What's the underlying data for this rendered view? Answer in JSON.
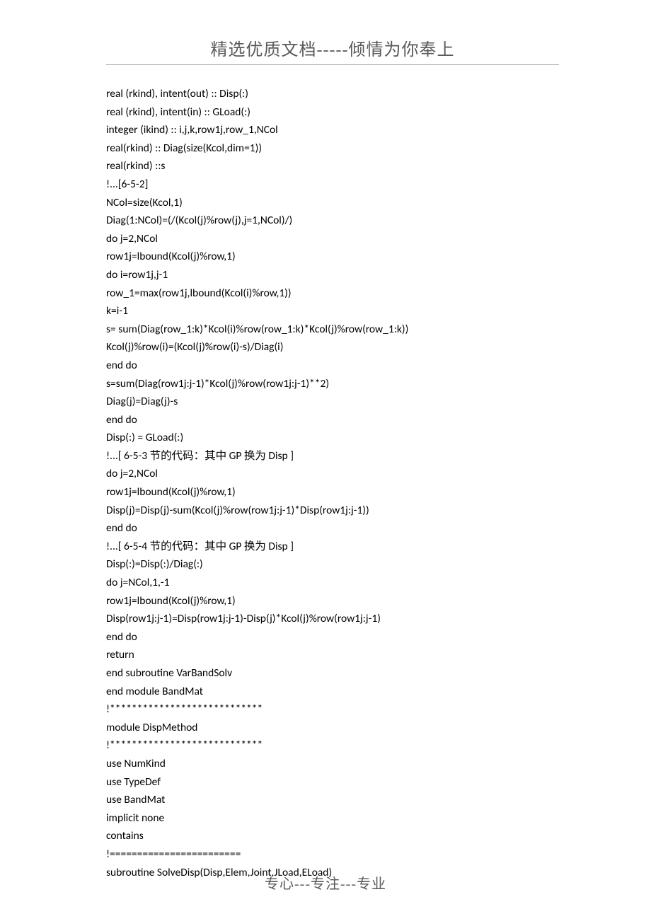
{
  "header": "精选优质文档-----倾情为你奉上",
  "footer": "专心---专注---专业",
  "code_lines": [
    "real (rkind), intent(out) :: Disp(:)",
    "real (rkind), intent(in) :: GLoad(:)",
    "integer (ikind) :: i,j,k,row1j,row_1,NCol",
    "real(rkind) :: Diag(size(Kcol,dim=1))",
    "real(rkind) ::s",
    "!...[6-5-2]",
    "NCol=size(Kcol,1)",
    "Diag(1:NCol)=(/(Kcol(j)%row(j),j=1,NCol)/)",
    "do j=2,NCol",
    "row1j=lbound(Kcol(j)%row,1)",
    "do i=row1j,j-1",
    "row_1=max(row1j,lbound(Kcol(i)%row,1))",
    "k=i-1",
    "s= sum(Diag(row_1:k)*Kcol(i)%row(row_1:k)*Kcol(j)%row(row_1:k))",
    "Kcol(j)%row(i)=(Kcol(j)%row(i)-s)/Diag(i)",
    "end do",
    "s=sum(Diag(row1j:j-1)*Kcol(j)%row(row1j:j-1)**2)",
    "Diag(j)=Diag(j)-s",
    "end do",
    "Disp(:) = GLoad(:)",
    "!...[ 6-5-3 节的代码：其中 GP 换为 Disp ]",
    "do j=2,NCol",
    "row1j=lbound(Kcol(j)%row,1)",
    "Disp(j)=Disp(j)-sum(Kcol(j)%row(row1j:j-1)*Disp(row1j:j-1))",
    "end do",
    "!...[ 6-5-4 节的代码：其中 GP 换为 Disp ]",
    "Disp(:)=Disp(:)/Diag(:)",
    "do j=NCol,1,-1",
    "row1j=lbound(Kcol(j)%row,1)",
    "Disp(row1j:j-1)=Disp(row1j:j-1)-Disp(j)*Kcol(j)%row(row1j:j-1)",
    "end do",
    "return",
    "end subroutine VarBandSolv",
    "end module BandMat",
    "!****************************",
    "module DispMethod",
    "!****************************",
    "use NumKind",
    "use TypeDef",
    "use BandMat",
    "implicit none",
    "contains",
    "!========================",
    "subroutine SolveDisp(Disp,Elem,Joint,JLoad,ELoad)"
  ]
}
